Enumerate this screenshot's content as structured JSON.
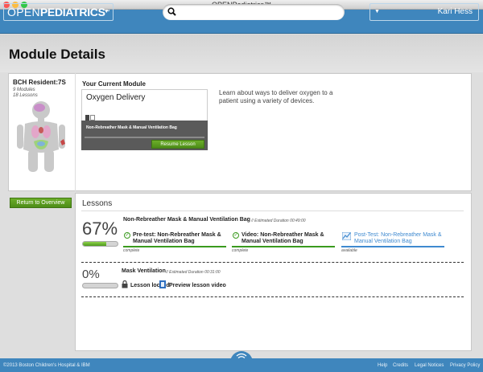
{
  "window": {
    "title": "OPENPediatrics™"
  },
  "header": {
    "logo_open": "OPEN",
    "logo_pediatrics": "PEDIATRICS",
    "logo_tm": "™",
    "search_placeholder": "",
    "search_value": "",
    "user_name": "Kari Hess"
  },
  "page": {
    "title": "Module Details"
  },
  "resident": {
    "name": "BCH Resident:7S",
    "modules": "9 Modules",
    "lessons": "18 Lessons"
  },
  "current_module": {
    "heading": "Your Current Module",
    "name": "Oxygen Delivery",
    "lesson": "Non-Rebreather Mask & Manual Ventilation Bag",
    "resume_label": "Resume Lesson",
    "description": "Learn about ways to deliver oxygen to a patient using a variety of devices."
  },
  "return_label": "Return to Overview",
  "lessons": {
    "heading": "Lessons",
    "items": [
      {
        "percent": "67%",
        "progress": 0.67,
        "title": "Non-Rebreather Mask & Manual Ventilation Bag",
        "duration": "Estimated Duration 00:49:00",
        "parts": [
          {
            "label": "Pre-test: Non-Rebreather Mask & Manual Ventilation Bag",
            "status": "complete"
          },
          {
            "label": "Video: Non-Rebreather Mask & Manual Ventilation Bag",
            "status": "complete"
          },
          {
            "label": "Post-Test: Non-Rebreather Mask & Manual Ventilation Bag",
            "status": "available"
          }
        ]
      },
      {
        "percent": "0%",
        "progress": 0,
        "title": "Mask Ventilation",
        "duration": "Estimated Duration 00:31:00",
        "locked_label": "Lesson locked",
        "preview_label": "Preview lesson video"
      }
    ]
  },
  "footer": {
    "copyright": "©2013 Boston Children's Hospital & IBM",
    "links": [
      "Help",
      "Credits",
      "Legal Notices",
      "Privacy Policy"
    ]
  },
  "colors": {
    "brand_blue": "#3f86bd",
    "green": "#4d8c18",
    "complete_line": "#3a9a1e",
    "available_line": "#3f8ad0"
  }
}
